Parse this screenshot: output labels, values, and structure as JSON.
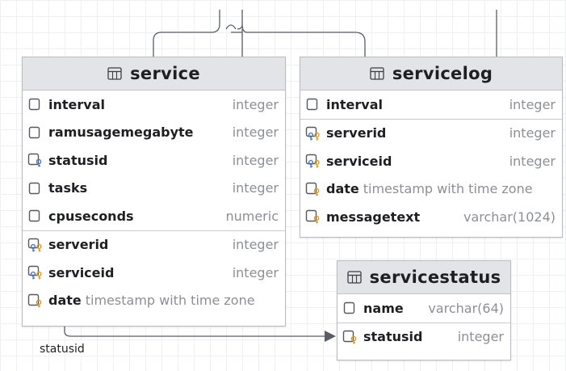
{
  "tables": {
    "service": {
      "title": "service",
      "sections": [
        [
          {
            "name": "interval",
            "type": "integer",
            "icon": "column-icon"
          },
          {
            "name": "ramusagemegabyte",
            "type": "integer",
            "icon": "column-icon"
          },
          {
            "name": "statusid",
            "type": "integer",
            "icon": "foreign-key-icon"
          },
          {
            "name": "tasks",
            "type": "integer",
            "icon": "column-icon"
          },
          {
            "name": "cpuseconds",
            "type": "numeric",
            "icon": "column-icon"
          }
        ],
        [
          {
            "name": "serverid",
            "type": "integer",
            "icon": "primary-foreign-key-icon"
          },
          {
            "name": "serviceid",
            "type": "integer",
            "icon": "primary-foreign-key-icon"
          },
          {
            "name": "date",
            "type": "timestamp with time zone",
            "icon": "primary-key-icon"
          }
        ]
      ]
    },
    "servicelog": {
      "title": "servicelog",
      "sections": [
        [
          {
            "name": "interval",
            "type": "integer",
            "icon": "column-icon"
          }
        ],
        [
          {
            "name": "serverid",
            "type": "integer",
            "icon": "primary-foreign-key-icon"
          },
          {
            "name": "serviceid",
            "type": "integer",
            "icon": "primary-foreign-key-icon"
          },
          {
            "name": "date",
            "type": "timestamp with time zone",
            "icon": "primary-key-icon"
          },
          {
            "name": "messagetext",
            "type": "varchar(1024)",
            "icon": "primary-key-icon"
          }
        ]
      ]
    },
    "servicestatus": {
      "title": "servicestatus",
      "sections": [
        [
          {
            "name": "name",
            "type": "varchar(64)",
            "icon": "column-icon"
          }
        ],
        [
          {
            "name": "statusid",
            "type": "integer",
            "icon": "primary-key-icon"
          }
        ]
      ]
    }
  },
  "relations": {
    "service_to_servicestatus_label": "statusid"
  },
  "colors": {
    "key_gold": "#d39a2b",
    "key_blue": "#4f78b8",
    "icon_gray": "#55585e",
    "connector": "#5a5d63"
  }
}
